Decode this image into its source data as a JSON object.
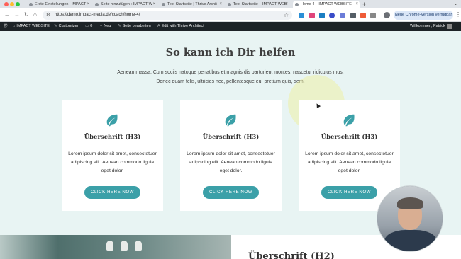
{
  "browser": {
    "tabs": [
      {
        "title": "Erste Einstellungen | IMPACT",
        "active": false
      },
      {
        "title": "Seite hinzufügen ‹ IMPACT W",
        "active": false
      },
      {
        "title": "Test Startseite | Thrive Archit",
        "active": false
      },
      {
        "title": "Test Startseite – IMPACT WEB",
        "active": false
      },
      {
        "title": "Home 4 – IMPACT WEBSITE",
        "active": true
      }
    ],
    "url": "https://demo.impact-media.de/coach/home-4/",
    "update_button": "Neue Chrome-Version verfügbar"
  },
  "wp_admin_bar": {
    "site_name": "IMPACT WEBSITE",
    "customize": "Customizer",
    "comments_count": "0",
    "new": "Neu",
    "edit_page": "Seite bearbeiten",
    "edit_thrive": "Edit with Thrive Architect",
    "greeting": "Willkommen, Patrick"
  },
  "section": {
    "heading": "So kann ich Dir helfen",
    "intro": "Aenean massa. Cum sociis natoque penatibus et magnis dis parturient montes, nascetur ridiculus mus. Donec quam felis, ultricies nec, pellentesque eu, pretium quis, sem."
  },
  "cards": [
    {
      "icon": "leaf-icon",
      "title": "Überschrift (H3)",
      "text": "Lorem ipsum dolor sit amet, consectetuer adipiscing elit. Aenean commodo ligula eget dolor.",
      "button": "CLICK HERE NOW"
    },
    {
      "icon": "leaf-icon",
      "title": "Überschrift (H3)",
      "text": "Lorem ipsum dolor sit amet, consectetuer adipiscing elit. Aenean commodo ligula eget dolor.",
      "button": "CLICK HERE NOW"
    },
    {
      "icon": "leaf-icon",
      "title": "Überschrift (H3)",
      "text": "Lorem ipsum dolor sit amet, consectetuer adipiscing elit. Aenean commodo ligula eget dolor.",
      "button": "CLICK HERE NOW"
    }
  ],
  "next_section": {
    "title": "Überschrift (H2)"
  },
  "colors": {
    "accent": "#3ba0a8",
    "section_bg": "#e8f4f3",
    "wp_bar": "#1d2327"
  }
}
